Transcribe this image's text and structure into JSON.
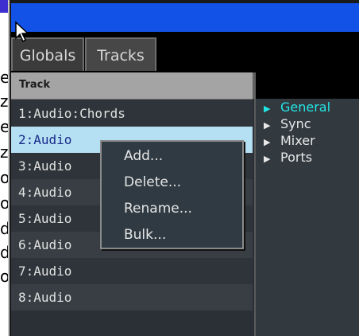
{
  "background_letters": [
    "e",
    "z",
    "e",
    "z",
    "o",
    "o",
    "d",
    "d",
    "o"
  ],
  "tabs": [
    {
      "label": "Globals"
    },
    {
      "label": "Tracks"
    }
  ],
  "track_list": {
    "header": "Track",
    "rows": [
      {
        "label": "1:Audio:Chords"
      },
      {
        "label": "2:Audio",
        "selected": true
      },
      {
        "label": "3:Audio"
      },
      {
        "label": "4:Audio"
      },
      {
        "label": "5:Audio"
      },
      {
        "label": "6:Audio"
      },
      {
        "label": "7:Audio"
      },
      {
        "label": "8:Audio"
      }
    ]
  },
  "tree": {
    "items": [
      {
        "label": "General",
        "active": true
      },
      {
        "label": "Sync"
      },
      {
        "label": "Mixer"
      },
      {
        "label": "Ports"
      }
    ]
  },
  "context_menu": {
    "items": [
      {
        "label": "Add..."
      },
      {
        "label": "Delete..."
      },
      {
        "label": "Rename..."
      },
      {
        "label": "Bulk..."
      }
    ]
  },
  "colors": {
    "titlebar": "#1252e6",
    "selection": "#b5dff2",
    "active_tree_item": "#22e6e6"
  }
}
